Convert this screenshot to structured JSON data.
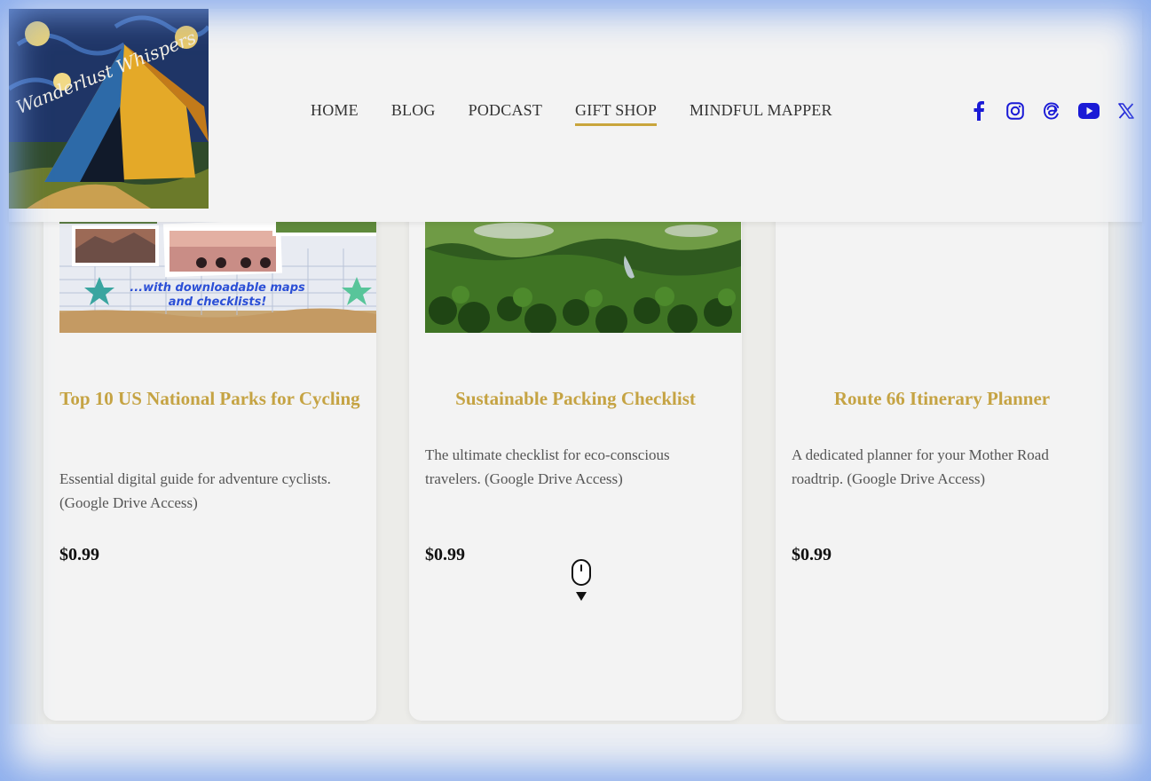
{
  "header": {
    "logo_text": "Wanderlust Whispers",
    "nav": [
      {
        "label": "HOME",
        "active": false
      },
      {
        "label": "BLOG",
        "active": false
      },
      {
        "label": "PODCAST",
        "active": false
      },
      {
        "label": "GIFT SHOP",
        "active": true
      },
      {
        "label": "MINDFUL MAPPER",
        "active": false
      }
    ],
    "social_icons": [
      "facebook-icon",
      "instagram-icon",
      "threads-icon",
      "youtube-icon",
      "x-icon"
    ]
  },
  "products": [
    {
      "image_caption": "...with downloadable maps and checklists!",
      "title": "Top 10 US National Parks for Cycling",
      "description": "Essential digital guide for adventure cyclists. (Google Drive Access)",
      "price": "$0.99"
    },
    {
      "title": "Sustainable Packing Checklist",
      "description": "The ultimate checklist for eco-conscious travelers. (Google Drive Access)",
      "price": "$0.99"
    },
    {
      "title": "Route 66 Itinerary Planner",
      "description": "A dedicated planner for your Mother Road roadtrip. (Google Drive Access)",
      "price": "$0.99"
    }
  ],
  "colors": {
    "accent_gold": "#c5a343",
    "social_blue": "#1a1ad6",
    "header_bg": "#f3f3f3"
  }
}
